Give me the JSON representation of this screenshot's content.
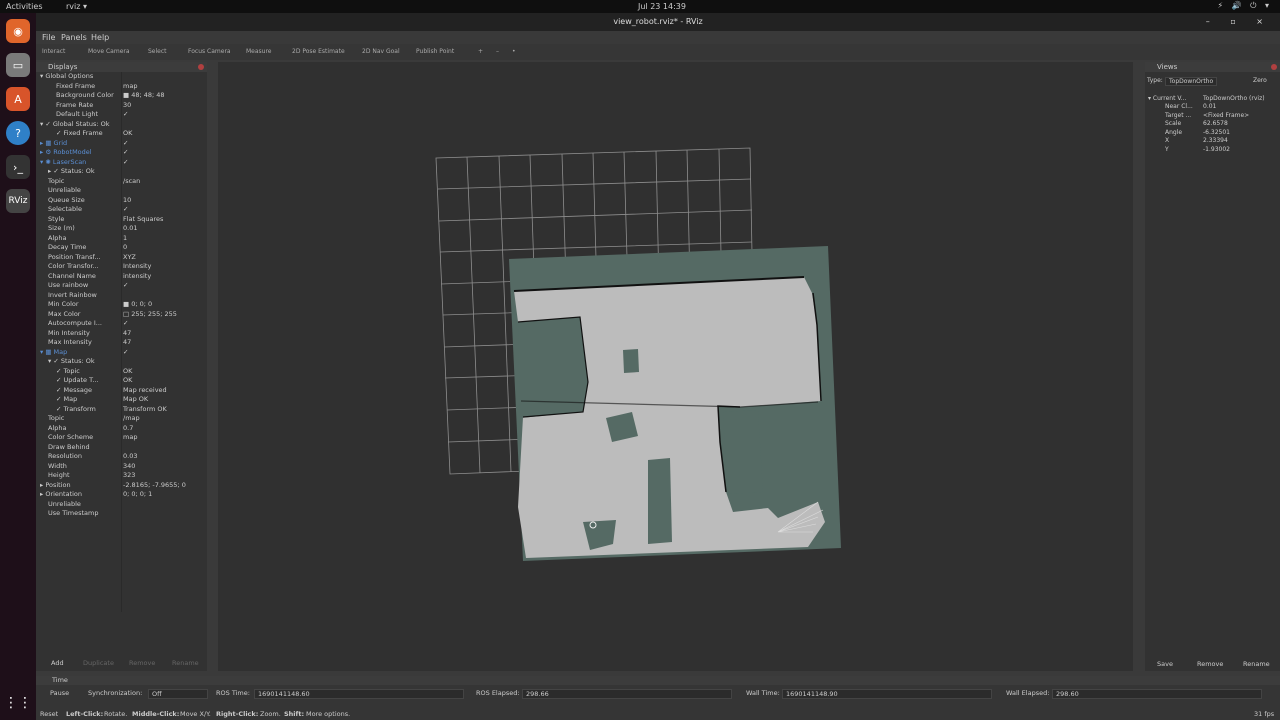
{
  "topbar": {
    "activities": "Activities",
    "app_menu": "rviz ▾",
    "clock": "Jul 23  14:39",
    "tray": "⚡ 🔊 ⏻ ▾"
  },
  "window": {
    "title": "view_robot.rviz* - RViz",
    "controls": "– ▫ ×"
  },
  "menu": {
    "file": "File",
    "panels": "Panels",
    "help": "Help"
  },
  "toolbar": [
    {
      "id": "interact",
      "label": "Interact"
    },
    {
      "id": "move-camera",
      "label": "Move Camera"
    },
    {
      "id": "select",
      "label": "Select"
    },
    {
      "id": "focus-camera",
      "label": "Focus Camera"
    },
    {
      "id": "measure",
      "label": "Measure"
    },
    {
      "id": "2d-pose",
      "label": "2D Pose Estimate"
    },
    {
      "id": "2d-nav",
      "label": "2D Nav Goal"
    },
    {
      "id": "publish-point",
      "label": "Publish Point"
    },
    {
      "id": "plus",
      "label": "+"
    },
    {
      "id": "minus",
      "label": "–"
    },
    {
      "id": "dot",
      "label": "•"
    }
  ],
  "displays": {
    "title": "Displays",
    "rows": [
      {
        "k": "▾  Global Options",
        "v": "",
        "i": 0
      },
      {
        "k": "Fixed Frame",
        "v": "map",
        "i": 2
      },
      {
        "k": "Background Color",
        "v": "■ 48; 48; 48",
        "i": 2
      },
      {
        "k": "Frame Rate",
        "v": "30",
        "i": 2
      },
      {
        "k": "Default Light",
        "v": "✓",
        "i": 2
      },
      {
        "k": "▾ ✓ Global Status: Ok",
        "v": "",
        "i": 0
      },
      {
        "k": "✓ Fixed Frame",
        "v": "OK",
        "i": 2
      },
      {
        "k": "▸ ▦ Grid",
        "v": "✓",
        "i": 0,
        "blue": true
      },
      {
        "k": "▸ ⚙ RobotModel",
        "v": "✓",
        "i": 0,
        "blue": true
      },
      {
        "k": "▾ ✺ LaserScan",
        "v": "✓",
        "i": 0,
        "blue": true
      },
      {
        "k": "▸ ✓ Status: Ok",
        "v": "",
        "i": 1
      },
      {
        "k": "Topic",
        "v": "/scan",
        "i": 1
      },
      {
        "k": "Unreliable",
        "v": "",
        "i": 1
      },
      {
        "k": "Queue Size",
        "v": "10",
        "i": 1
      },
      {
        "k": "Selectable",
        "v": "✓",
        "i": 1
      },
      {
        "k": "Style",
        "v": "Flat Squares",
        "i": 1
      },
      {
        "k": "Size (m)",
        "v": "0.01",
        "i": 1
      },
      {
        "k": "Alpha",
        "v": "1",
        "i": 1
      },
      {
        "k": "Decay Time",
        "v": "0",
        "i": 1
      },
      {
        "k": "Position Transf...",
        "v": "XYZ",
        "i": 1
      },
      {
        "k": "Color Transfor...",
        "v": "Intensity",
        "i": 1
      },
      {
        "k": "Channel Name",
        "v": "intensity",
        "i": 1
      },
      {
        "k": "Use rainbow",
        "v": "✓",
        "i": 1
      },
      {
        "k": "Invert Rainbow",
        "v": "",
        "i": 1
      },
      {
        "k": "Min Color",
        "v": "■ 0; 0; 0",
        "i": 1
      },
      {
        "k": "Max Color",
        "v": "□ 255; 255; 255",
        "i": 1
      },
      {
        "k": "Autocompute I...",
        "v": "✓",
        "i": 1
      },
      {
        "k": "Min Intensity",
        "v": "47",
        "i": 1
      },
      {
        "k": "Max Intensity",
        "v": "47",
        "i": 1
      },
      {
        "k": "▾ ▦ Map",
        "v": "✓",
        "i": 0,
        "blue": true
      },
      {
        "k": "▾ ✓ Status: Ok",
        "v": "",
        "i": 1
      },
      {
        "k": "✓ Topic",
        "v": "OK",
        "i": 2
      },
      {
        "k": "✓ Update T...",
        "v": "OK",
        "i": 2
      },
      {
        "k": "✓ Message",
        "v": "Map received",
        "i": 2
      },
      {
        "k": "✓ Map",
        "v": "Map OK",
        "i": 2
      },
      {
        "k": "✓ Transform",
        "v": "Transform OK",
        "i": 2
      },
      {
        "k": "Topic",
        "v": "/map",
        "i": 1
      },
      {
        "k": "Alpha",
        "v": "0.7",
        "i": 1
      },
      {
        "k": "Color Scheme",
        "v": "map",
        "i": 1
      },
      {
        "k": "Draw Behind",
        "v": "",
        "i": 1
      },
      {
        "k": "Resolution",
        "v": "0.03",
        "i": 1
      },
      {
        "k": "Width",
        "v": "340",
        "i": 1
      },
      {
        "k": "Height",
        "v": "323",
        "i": 1
      },
      {
        "k": "▸ Position",
        "v": "-2.8165; -7.9655; 0",
        "i": 0
      },
      {
        "k": "▸ Orientation",
        "v": "0; 0; 0; 1",
        "i": 0
      },
      {
        "k": "Unreliable",
        "v": "",
        "i": 1
      },
      {
        "k": "Use Timestamp",
        "v": "",
        "i": 1
      }
    ],
    "buttons": {
      "add": "Add",
      "duplicate": "Duplicate",
      "remove": "Remove",
      "rename": "Rename"
    }
  },
  "views": {
    "title": "Views",
    "type_label": "Type:",
    "type_value": "TopDownOrtho",
    "zero": "Zero",
    "current_key": "▾ Current V...",
    "current_val": "TopDownOrtho (rviz)",
    "props": [
      {
        "k": "Near Cl...",
        "v": "0.01"
      },
      {
        "k": "Target ...",
        "v": "<Fixed Frame>"
      },
      {
        "k": "Scale",
        "v": "62.6578"
      },
      {
        "k": "Angle",
        "v": "-6.32501"
      },
      {
        "k": "X",
        "v": "2.33394"
      },
      {
        "k": "Y",
        "v": "-1.93002"
      }
    ],
    "buttons": {
      "save": "Save",
      "remove": "Remove",
      "rename": "Rename"
    }
  },
  "time": {
    "title": "Time",
    "pause": "Pause",
    "sync_label": "Synchronization:",
    "sync_value": "Off",
    "ros_time_label": "ROS Time:",
    "ros_time": "1690141148.60",
    "ros_elapsed_label": "ROS Elapsed:",
    "ros_elapsed": "298.66",
    "wall_time_label": "Wall Time:",
    "wall_time": "1690141148.90",
    "wall_elapsed_label": "Wall Elapsed:",
    "wall_elapsed": "298.60"
  },
  "status": {
    "reset": "Reset",
    "hint1": "Left-Click:",
    "hint1v": "Rotate.",
    "hint2": "Middle-Click:",
    "hint2v": "Move X/Y.",
    "hint3": "Right-Click:",
    "hint3v": "Zoom.",
    "hint4": "Shift:",
    "hint4v": "More options.",
    "fps": "31 fps"
  },
  "colors": {
    "background": "#303030",
    "map_unknown": "#556a64",
    "map_free": "#bcbcbc",
    "grid": "#a0a0a0",
    "accent_blue": "#5b8fd4"
  }
}
